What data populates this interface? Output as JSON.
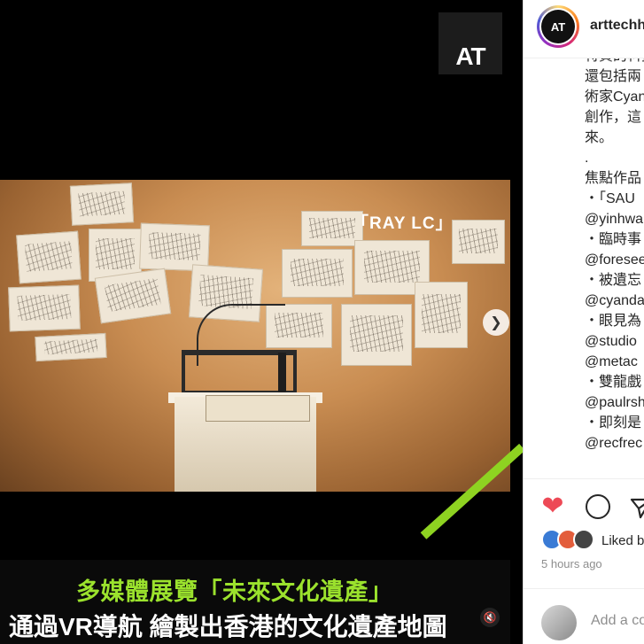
{
  "media": {
    "logo_text": "AT",
    "overlay_label": "「RAY LC」",
    "caption_line_1": "多媒體展覽「未來文化遺產」",
    "caption_line_2": "通過VR導航 繪製出香港的文化遺產地圖",
    "next_icon": "chevron-right-icon",
    "mute_icon": "speaker-muted-icon",
    "stripe_color": "#8ed321"
  },
  "post": {
    "username": "arttechhk",
    "avatar_text": "AT",
    "caption_lines": [
      "特質的科技",
      "還包括兩",
      "術家Cyan",
      "創作，這",
      "來。",
      ".",
      "焦點作品",
      "・「SAU",
      "@yinhwa",
      "・臨時事",
      "@foresee",
      "・被遺忘",
      "@cyanda",
      "・眼見為",
      "@studio",
      "@metac",
      "・雙龍戲",
      "@paulrsh",
      "・即刻是",
      "@recfrec"
    ],
    "likes_text": "Liked by",
    "timestamp": "5 hours ago",
    "comment_placeholder": "Add a comment",
    "heart_color": "#ed4956"
  }
}
